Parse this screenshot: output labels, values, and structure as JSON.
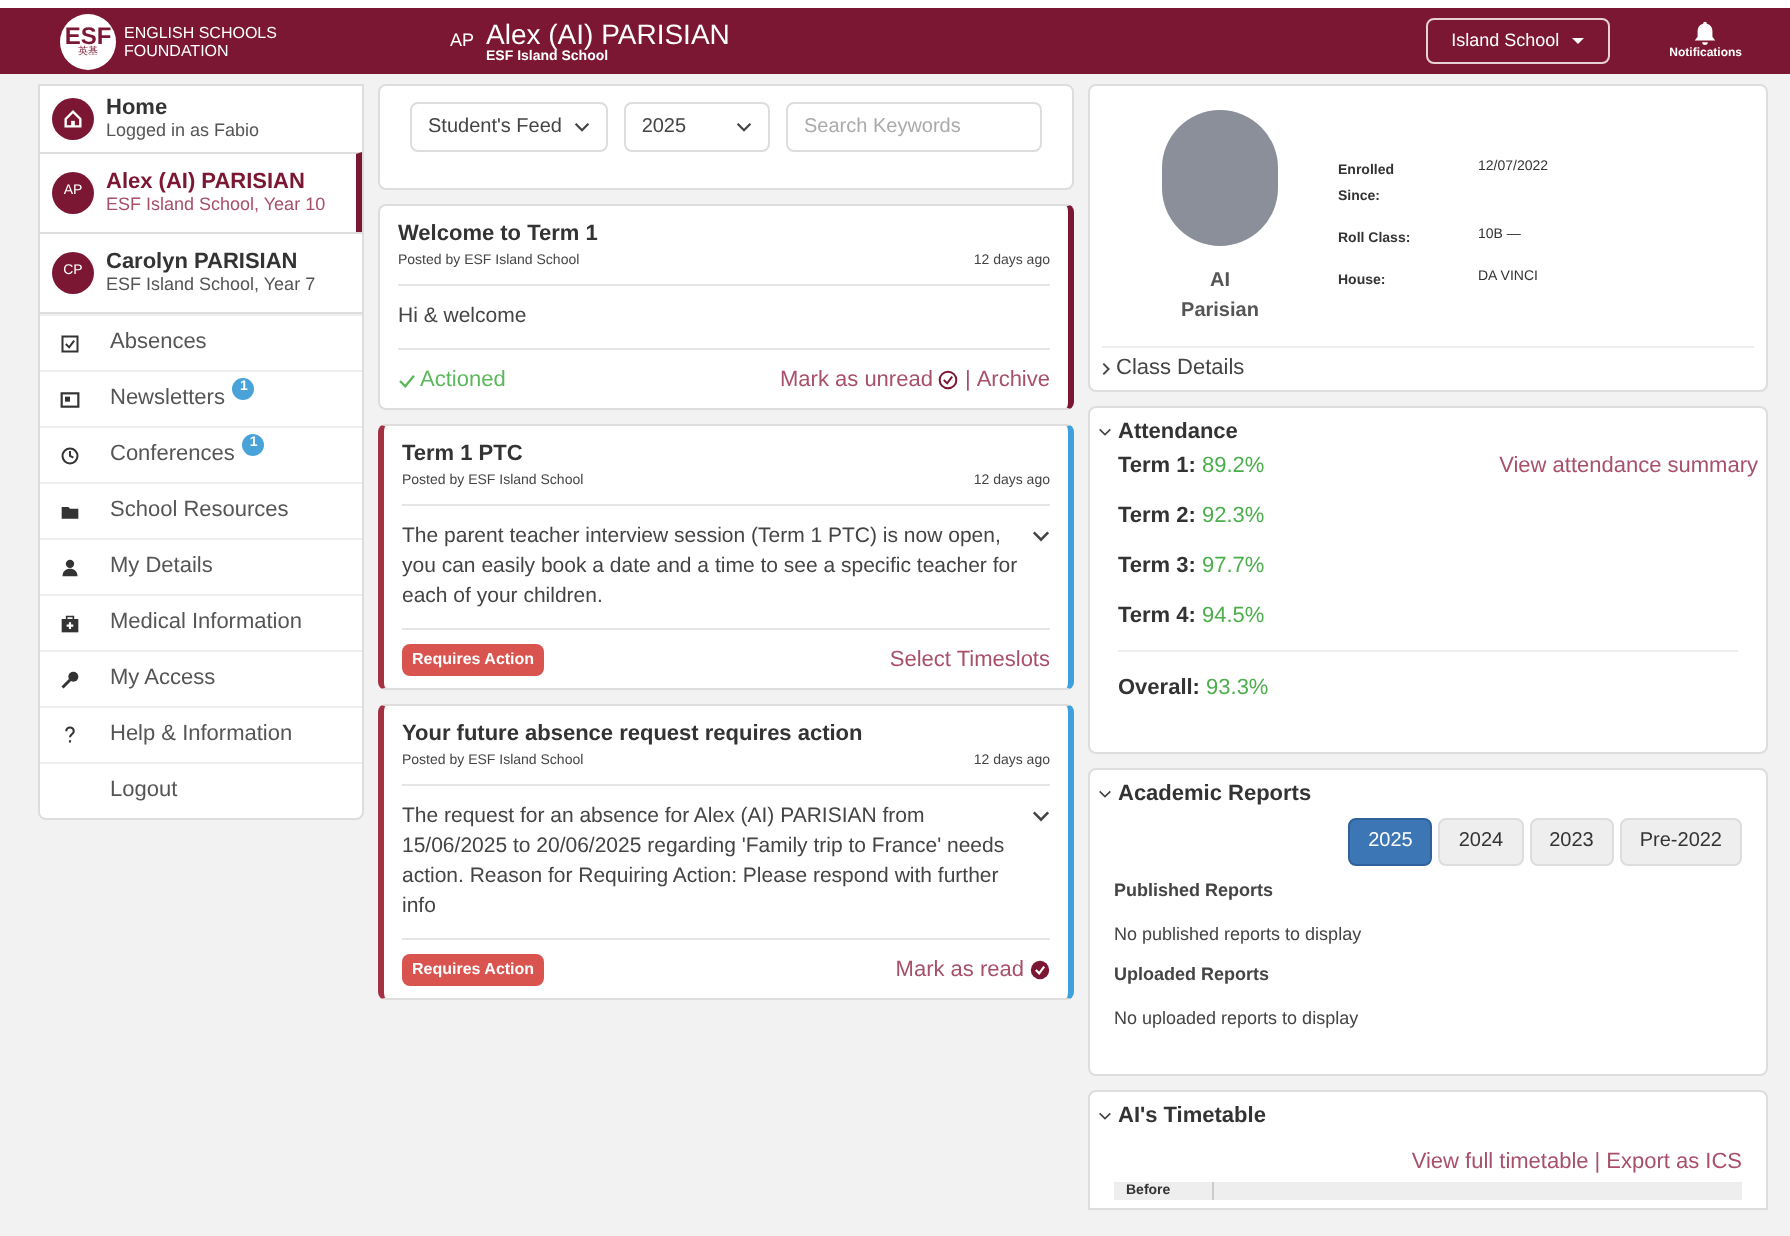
{
  "header": {
    "logo_mark": "ESF",
    "logo_sub": "英基",
    "org": [
      "ENGLISH SCHOOLS",
      "FOUNDATION"
    ],
    "initials": "AP",
    "student": "Alex (AI) PARISIAN",
    "school": "ESF Island School",
    "school_select": "Island School",
    "notifications": "Notifications"
  },
  "sidebar": {
    "people": [
      {
        "kind": "home",
        "title": "Home",
        "subtitle": "Logged in as Fabio",
        "selected": false
      },
      {
        "kind": "student",
        "initials": "AP",
        "title": "Alex (AI) PARISIAN",
        "subtitle": "ESF Island School, Year 10",
        "selected": true
      },
      {
        "kind": "student",
        "initials": "CP",
        "title": "Carolyn PARISIAN",
        "subtitle": "ESF Island School, Year 7",
        "selected": false
      }
    ],
    "items": [
      {
        "kind": "check",
        "label": "Absences"
      },
      {
        "kind": "news",
        "label": "Newsletters",
        "badge": "1"
      },
      {
        "kind": "clock",
        "label": "Conferences",
        "badge": "1"
      },
      {
        "kind": "folder",
        "label": "School Resources"
      },
      {
        "kind": "person",
        "label": "My Details"
      },
      {
        "kind": "medkit",
        "label": "Medical Information"
      },
      {
        "kind": "key",
        "label": "My Access"
      },
      {
        "kind": "question",
        "label": "Help & Information"
      },
      {
        "kind": "plain",
        "label": "Logout"
      }
    ]
  },
  "filters": {
    "feed": "Student's Feed",
    "year": "2025",
    "search_placeholder": "Search Keywords"
  },
  "feed": [
    {
      "title": "Welcome to Term 1",
      "posted": "Posted by ESF Island School",
      "age": "12 days ago",
      "body": "Hi & welcome",
      "read": true,
      "requires_action": false,
      "expandable": false,
      "status": "Actioned",
      "actions": [
        {
          "kind": "unread",
          "label": "Mark as unread"
        },
        {
          "kind": "link",
          "label": "Archive"
        }
      ],
      "separator": "|"
    },
    {
      "title": "Term 1 PTC",
      "posted": "Posted by ESF Island School",
      "age": "12 days ago",
      "body": "The parent teacher interview session (Term 1 PTC) is now open, you can easily book a date and a time to see a specific teacher for each of your children.",
      "read": false,
      "requires_action": true,
      "badge": "Requires Action",
      "expandable": true,
      "actions": [
        {
          "kind": "link",
          "label": "Select Timeslots"
        }
      ]
    },
    {
      "title": "Your future absence request requires action",
      "posted": "Posted by ESF Island School",
      "age": "12 days ago",
      "body": "The request for an absence for Alex (AI) PARISIAN from 15/06/2025 to 20/06/2025 regarding 'Family trip to France' needs action. Reason for Requiring Action: Please respond with further info",
      "read": false,
      "requires_action": true,
      "badge": "Requires Action",
      "expandable": true,
      "actions": [
        {
          "kind": "read",
          "label": "Mark as read"
        }
      ]
    }
  ],
  "profile": {
    "first": "AI",
    "last": "Parisian",
    "details": [
      {
        "label": "Enrolled Since:",
        "value": "12/07/2022"
      },
      {
        "label": "Roll Class:",
        "value": "10B —"
      },
      {
        "label": "House:",
        "value": "DA VINCI"
      }
    ],
    "class_details": "Class Details",
    "expanded": false
  },
  "attendance": {
    "title": "Attendance",
    "link": "View attendance summary",
    "terms": [
      {
        "label": "Term 1:",
        "value": "89.2%"
      },
      {
        "label": "Term 2:",
        "value": "92.3%"
      },
      {
        "label": "Term 3:",
        "value": "97.7%"
      },
      {
        "label": "Term 4:",
        "value": "94.5%"
      }
    ],
    "overall": {
      "label": "Overall:",
      "value": "93.3%"
    }
  },
  "reports": {
    "title": "Academic Reports",
    "years": [
      {
        "label": "2025",
        "selected": true
      },
      {
        "label": "2024",
        "selected": false
      },
      {
        "label": "2023",
        "selected": false
      },
      {
        "label": "Pre-2022",
        "selected": false
      }
    ],
    "sections": [
      {
        "title": "Published Reports",
        "text": "No published reports to display"
      },
      {
        "title": "Uploaded Reports",
        "text": "No uploaded reports to display"
      }
    ]
  },
  "timetable": {
    "title": "AI's Timetable",
    "links": [
      "View full timetable",
      "Export as ICS"
    ],
    "separator": "|",
    "column_1": "Before"
  }
}
